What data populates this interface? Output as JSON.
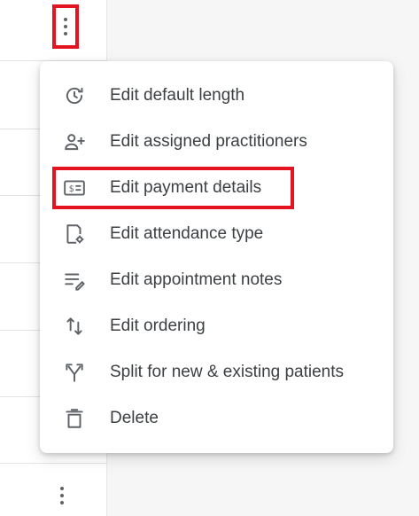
{
  "menu": {
    "items": [
      {
        "label": "Edit default length",
        "icon": "clock-history-icon"
      },
      {
        "label": "Edit assigned practitioners",
        "icon": "person-add-icon"
      },
      {
        "label": "Edit payment details",
        "icon": "payment-card-icon"
      },
      {
        "label": "Edit attendance type",
        "icon": "attendance-type-icon"
      },
      {
        "label": "Edit appointment notes",
        "icon": "notes-edit-icon"
      },
      {
        "label": "Edit ordering",
        "icon": "sort-arrows-icon"
      },
      {
        "label": "Split for new & existing patients",
        "icon": "split-icon"
      },
      {
        "label": "Delete",
        "icon": "trash-icon"
      }
    ]
  },
  "colors": {
    "highlight": "#e3131f",
    "icon": "#5f6368",
    "text": "#3c4043"
  }
}
